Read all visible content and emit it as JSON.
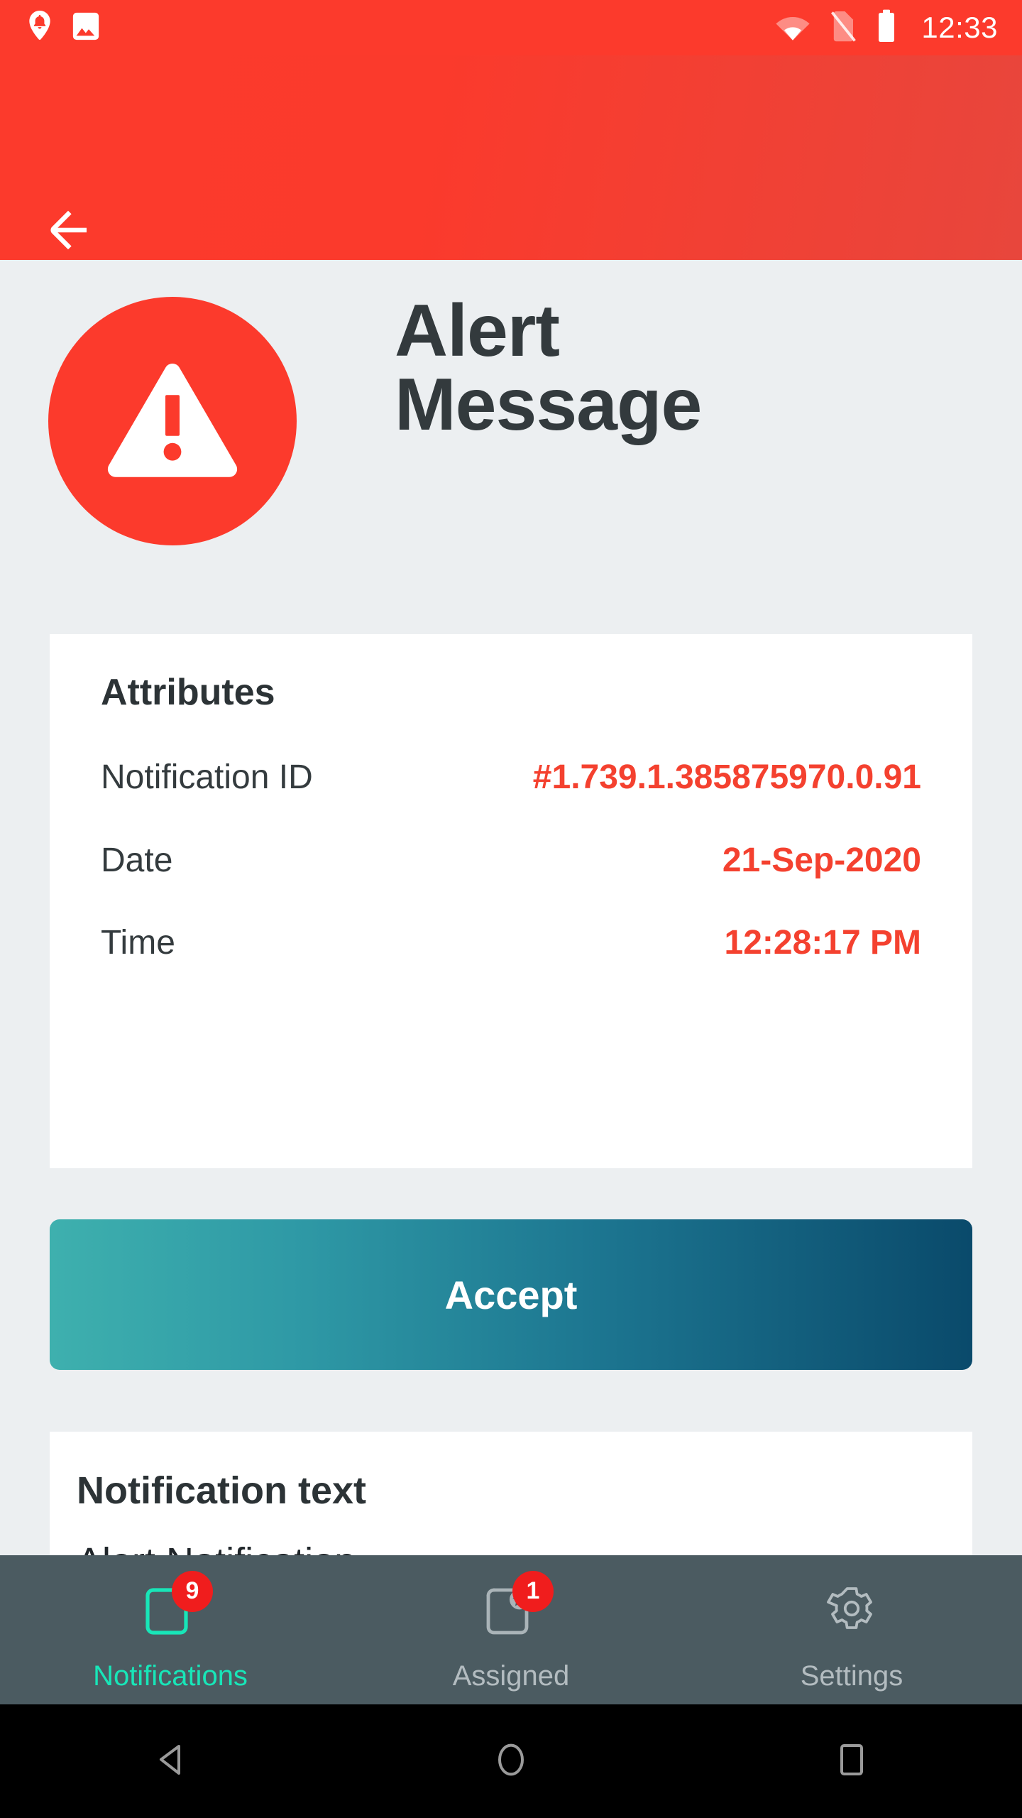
{
  "statusbar": {
    "clock": "12:33",
    "icons_left": [
      "notification-bell-icon",
      "image-icon"
    ],
    "icons_right": [
      "wifi-icon",
      "no-sim-icon",
      "battery-icon"
    ]
  },
  "appbar": {
    "back_label": "",
    "back_icon": "arrow-back-icon",
    "background_color": "#fc3a2c"
  },
  "hero": {
    "icon": "warning-triangle-icon",
    "icon_bg_color": "#fc3a2c",
    "title_line1": "Alert",
    "title_line2": "Message",
    "title_color": "#333a3d"
  },
  "attributes_card": {
    "title": "Attributes",
    "value_color": "#f4412f",
    "rows": [
      {
        "label": "Notification ID",
        "value": "#1.739.1.385875970.0.91"
      },
      {
        "label": "Date",
        "value": "21-Sep-2020"
      },
      {
        "label": "Time",
        "value": "12:28:17 PM"
      }
    ]
  },
  "accept_button": {
    "label": "Accept",
    "gradient_from": "#3eb0ae",
    "gradient_to": "#0a4a6b"
  },
  "notification_card": {
    "heading": "Notification text",
    "body": "Alert Notification"
  },
  "tabbar": {
    "background_color": "#4b5b61",
    "active_color": "#18e6b8",
    "inactive_color": "#b3bcc0",
    "badge_color": "#f01d1d",
    "tabs": [
      {
        "label": "Notifications",
        "icon": "notifications-card-icon",
        "badge": "9",
        "active": true
      },
      {
        "label": "Assigned",
        "icon": "assigned-star-icon",
        "badge": "1",
        "active": false
      },
      {
        "label": "Settings",
        "icon": "gear-icon",
        "badge": "",
        "active": false
      }
    ]
  },
  "sysnav": {
    "buttons": [
      {
        "name": "android-back",
        "icon": "triangle-left-icon"
      },
      {
        "name": "android-home",
        "icon": "circle-icon"
      },
      {
        "name": "android-recents",
        "icon": "square-icon"
      }
    ]
  }
}
